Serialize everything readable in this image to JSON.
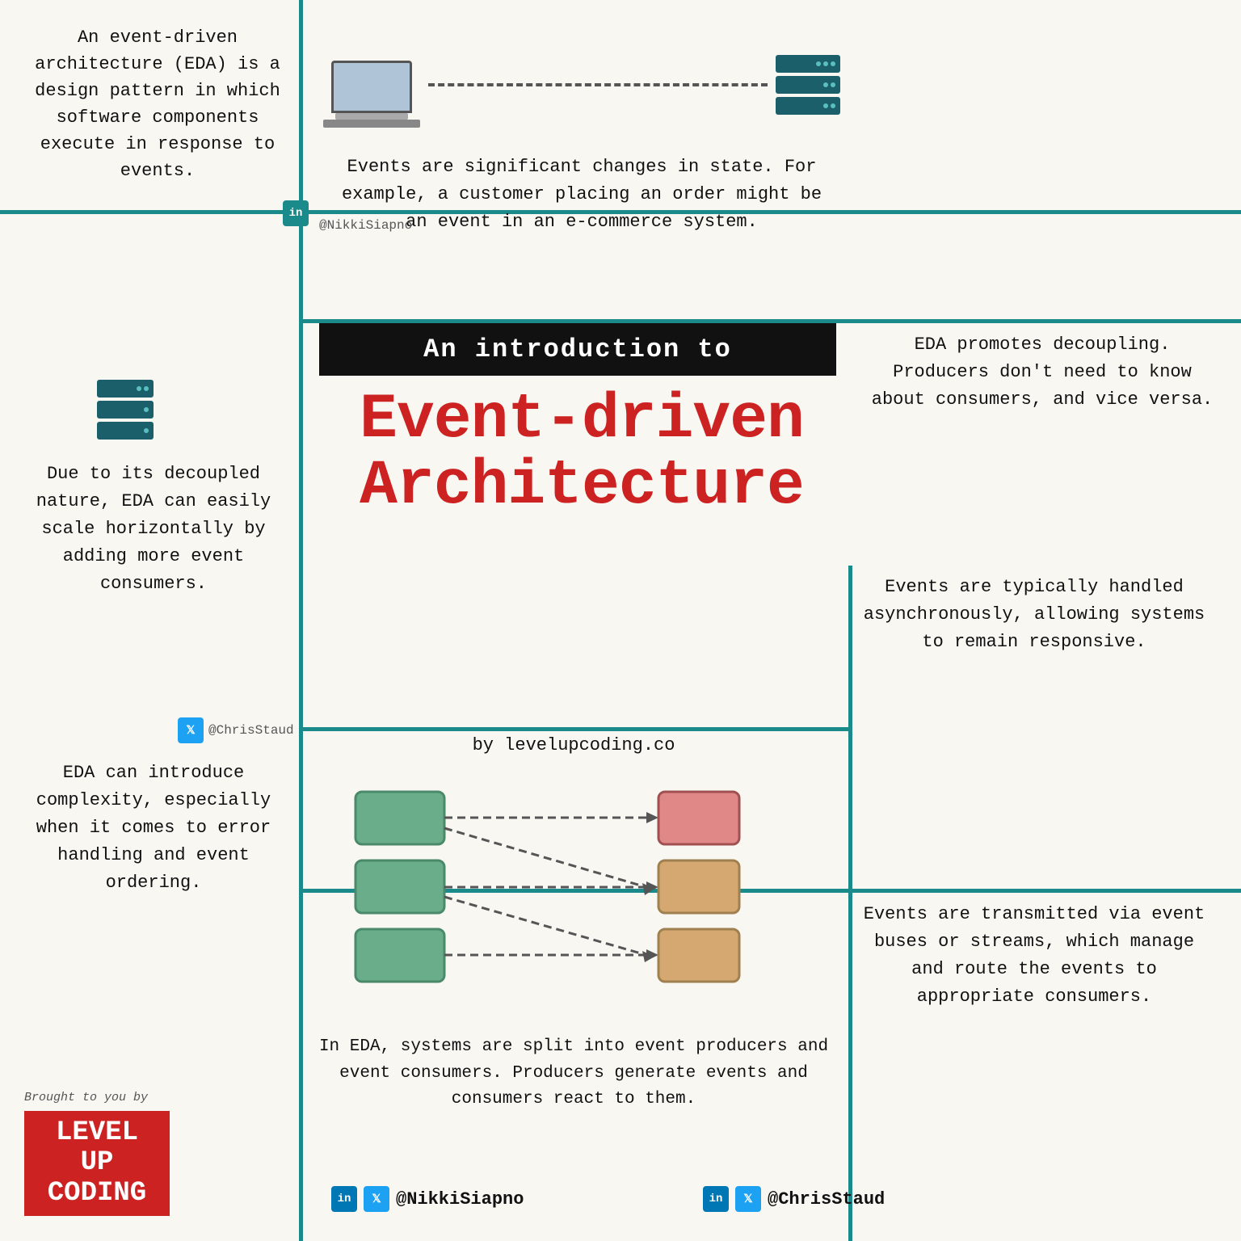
{
  "page": {
    "background": "#f9f7f2"
  },
  "top_left": {
    "definition": "An event-driven architecture (EDA) is a design pattern in which software components execute in response to events."
  },
  "top_right": {
    "events_description": "Events are significant changes in state. For example, a customer placing an order might be an event in an e-commerce system."
  },
  "intro_banner": {
    "text": "An introduction to"
  },
  "main_title": {
    "line1": "Event-driven",
    "line2": "Architecture"
  },
  "decoupling": {
    "text": "EDA promotes decoupling. Producers don't need to know about consumers, and vice versa."
  },
  "scale": {
    "text": "Due to its decoupled nature, EDA can easily scale horizontally by adding more event consumers."
  },
  "complexity": {
    "text": "EDA can introduce complexity, especially when it comes to error handling and event ordering."
  },
  "async": {
    "text": "Events are typically handled asynchronously, allowing systems to remain responsive."
  },
  "buses": {
    "text": "Events are transmitted via event buses or streams, which manage and route the events to appropriate consumers."
  },
  "by_label": {
    "text": "by levelupcoding.co"
  },
  "eda_systems": {
    "text": "In EDA, systems are split into event producers and event consumers. Producers generate events and consumers react to them."
  },
  "credits": {
    "nikki": "@NikkiSiapno",
    "chris": "@ChrisStaud"
  },
  "brought_by": {
    "label": "Brought to you by",
    "brand_line1": "LEVEL UP",
    "brand_line2": "CODING"
  },
  "socials": {
    "left_handle": "@NikkiSiapno",
    "right_handle": "@ChrisStaud"
  }
}
